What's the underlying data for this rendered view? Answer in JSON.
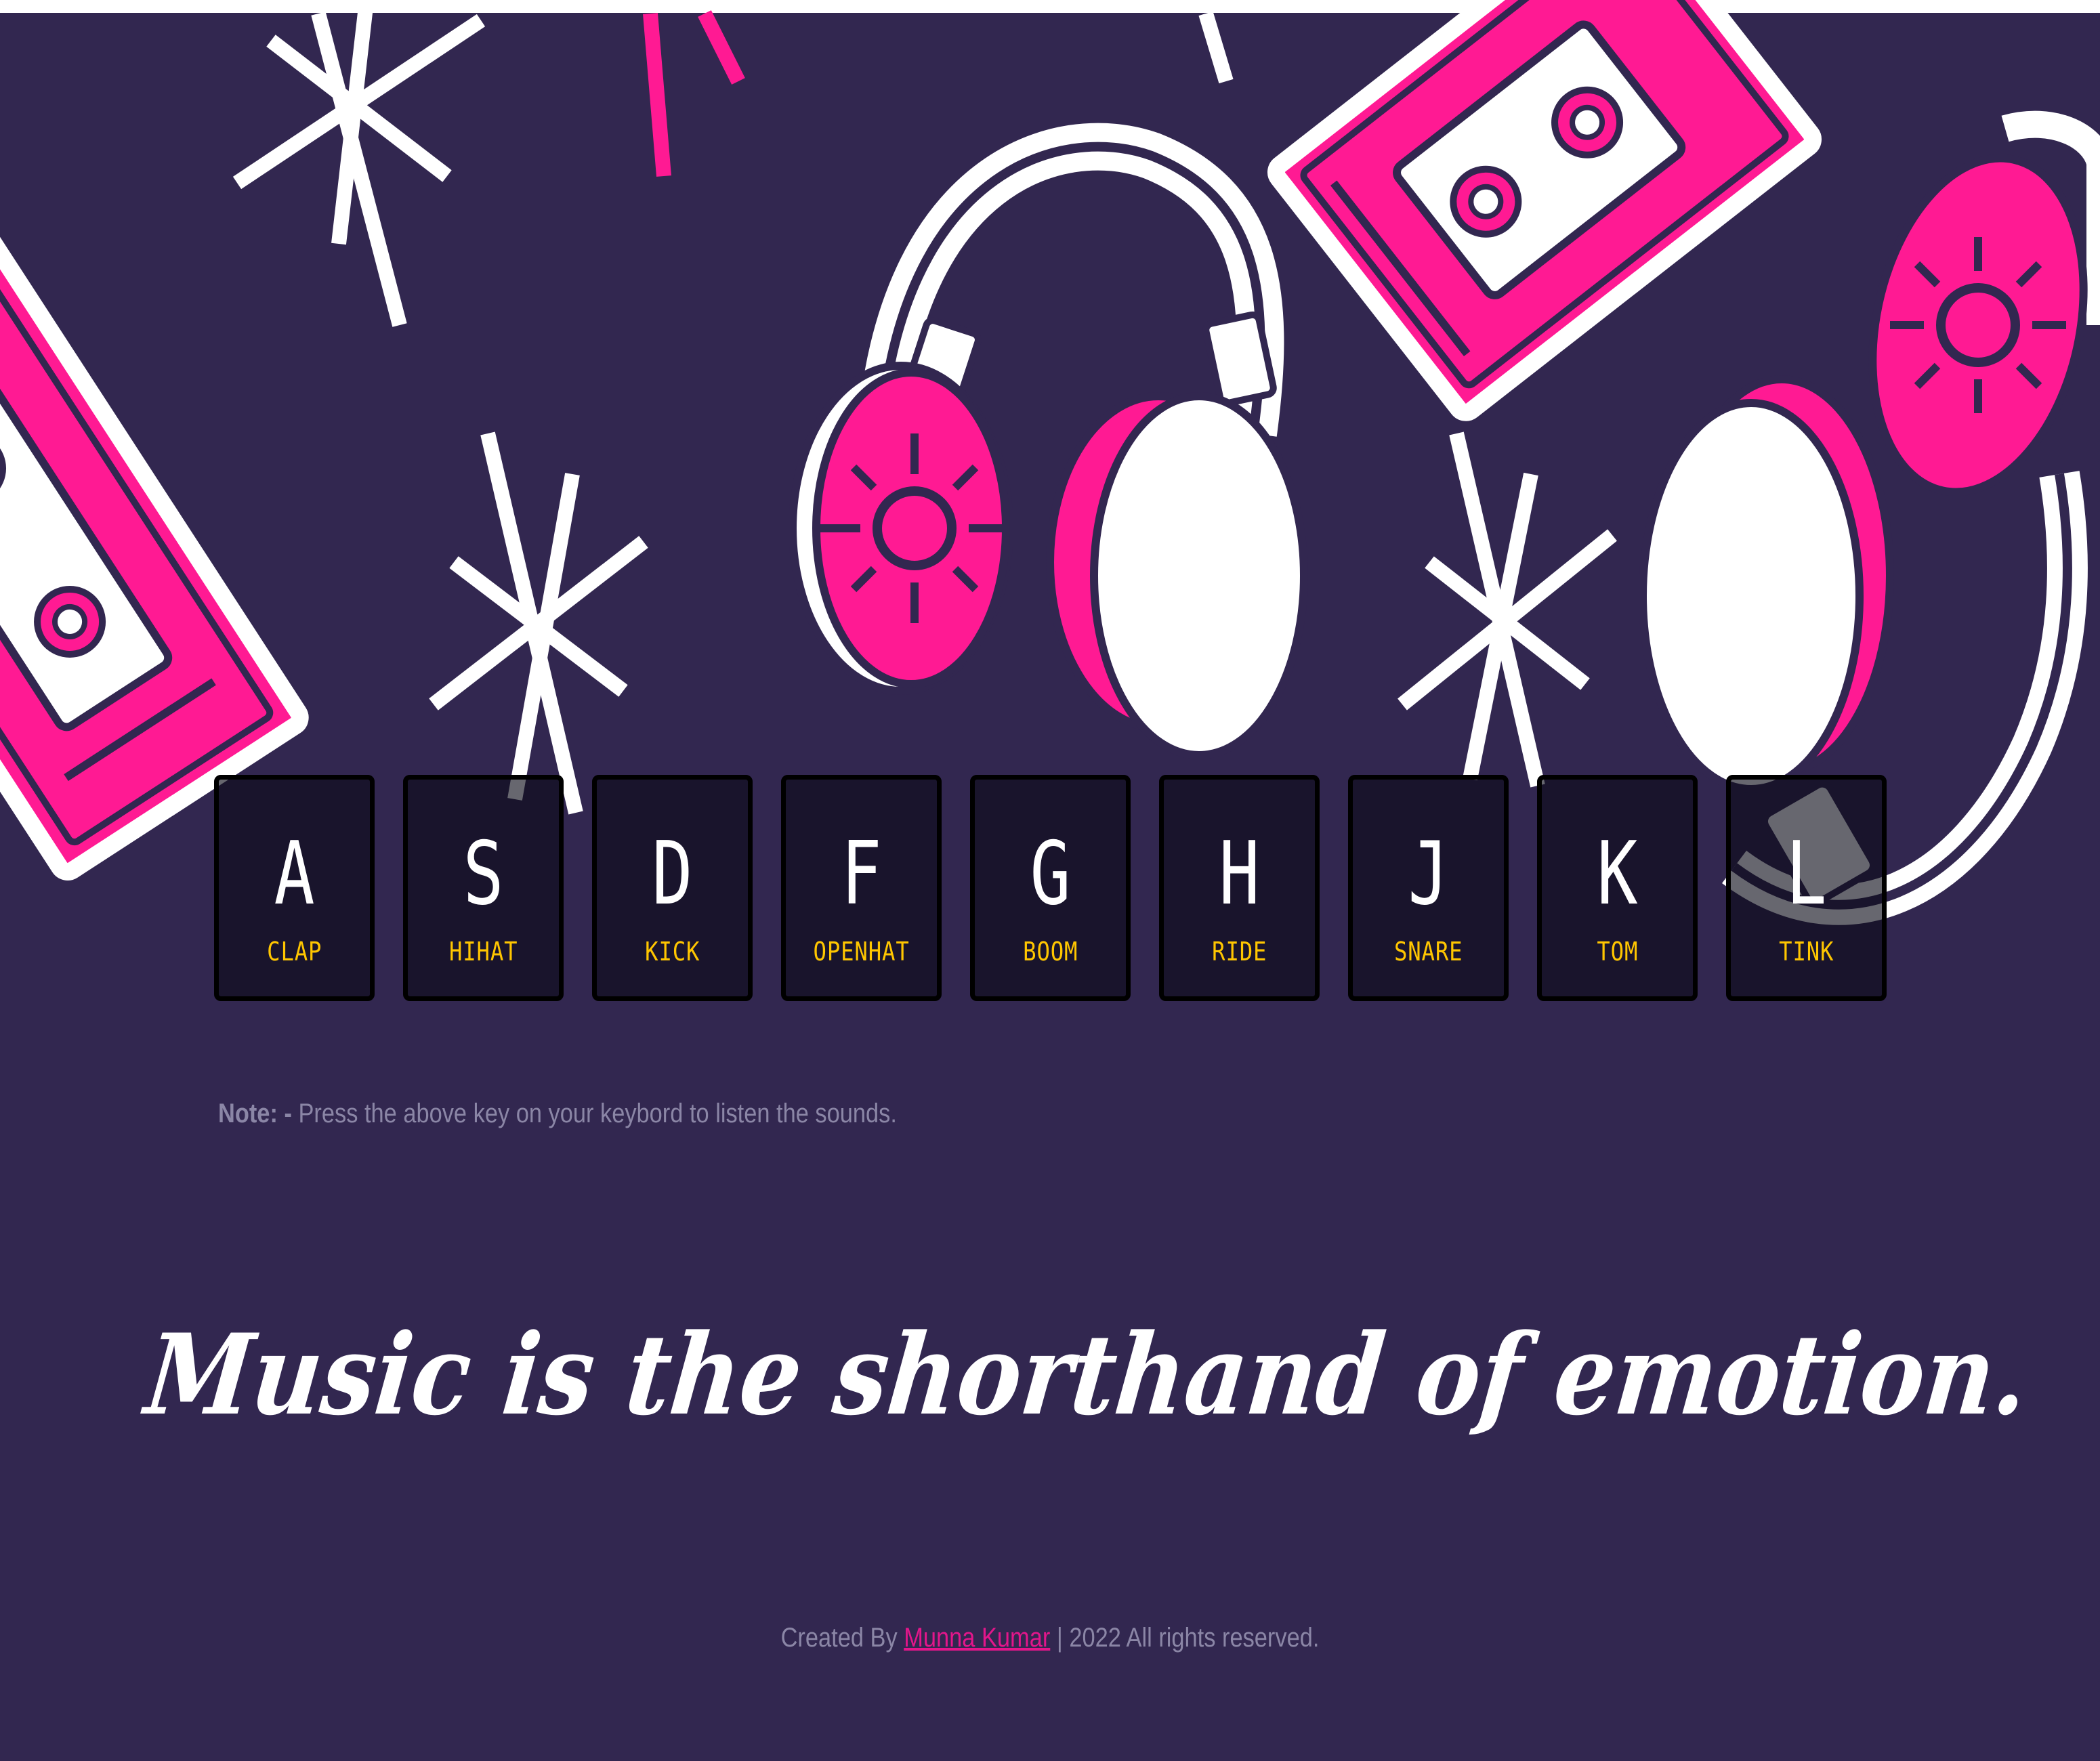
{
  "keys": [
    {
      "letter": "A",
      "sound": "CLAP"
    },
    {
      "letter": "S",
      "sound": "HIHAT"
    },
    {
      "letter": "D",
      "sound": "KICK"
    },
    {
      "letter": "F",
      "sound": "OPENHAT"
    },
    {
      "letter": "G",
      "sound": "BOOM"
    },
    {
      "letter": "H",
      "sound": "RIDE"
    },
    {
      "letter": "J",
      "sound": "SNARE"
    },
    {
      "letter": "K",
      "sound": "TOM"
    },
    {
      "letter": "L",
      "sound": "TINK"
    }
  ],
  "note": {
    "label": "Note: -",
    "text": " Press the above key on your keybord to listen the sounds."
  },
  "quote": "Music is the shorthand of emotion.",
  "footer": {
    "prefix": "Created By ",
    "author": "Munna Kumar",
    "suffix": " | 2022 All rights reserved."
  },
  "colors": {
    "background": "#322750",
    "accent_pink": "#ff1a93",
    "sound_label": "#ffc600",
    "note_text": "#8b86a6",
    "footer_link": "#e3168b"
  },
  "icons": [
    "cassette-tape-icon",
    "headphones-icon",
    "sparkle-star-icon"
  ]
}
